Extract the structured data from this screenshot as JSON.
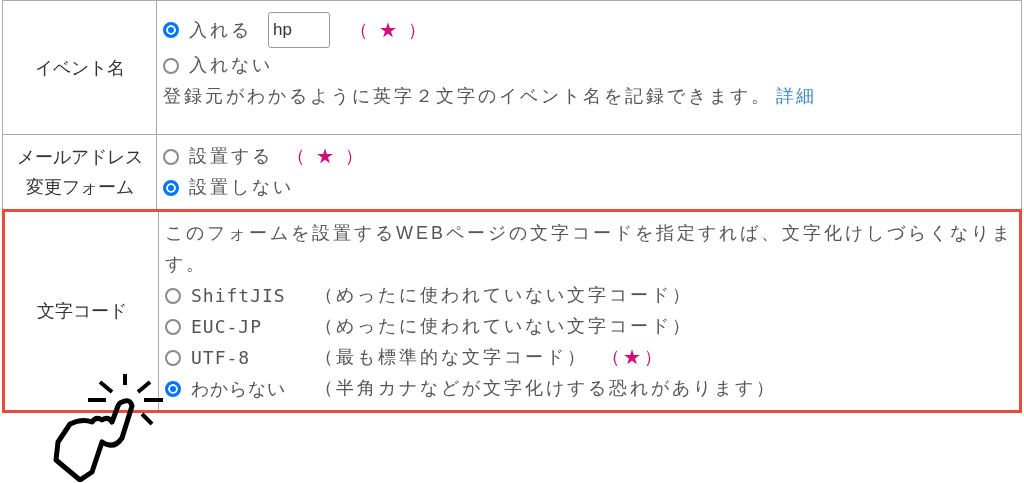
{
  "rows": [
    {
      "label": "イベント名",
      "highlighted": false,
      "options": [
        {
          "label": "入れる",
          "selected": true,
          "input_value": "hp",
          "mark": "（ ★ ）"
        },
        {
          "label": "入れない",
          "selected": false
        }
      ],
      "description": "登録元がわかるように英字２文字のイベント名を記録できます。",
      "link": "詳細"
    },
    {
      "label": "メールアドレス変更フォーム",
      "highlighted": false,
      "options": [
        {
          "label": "設置する",
          "selected": false,
          "mark": "（ ★ ）"
        },
        {
          "label": "設置しない",
          "selected": true
        }
      ]
    },
    {
      "label": "文字コード",
      "highlighted": true,
      "description": "このフォームを設置するWEBページの文字コードを指定すれば、文字化けしづらくなります。",
      "options": [
        {
          "code": "ShiftJIS",
          "note": "（めったに使われていない文字コード）",
          "selected": false
        },
        {
          "code": "EUC-JP",
          "note": "（めったに使われていない文字コード）",
          "selected": false
        },
        {
          "code": "UTF-8",
          "note": "（最も標準的な文字コード）",
          "selected": false,
          "mark": "（★）"
        },
        {
          "code": "わからない",
          "note": "（半角カナなどが文字化けする恐れがあります）",
          "selected": true
        }
      ]
    }
  ]
}
